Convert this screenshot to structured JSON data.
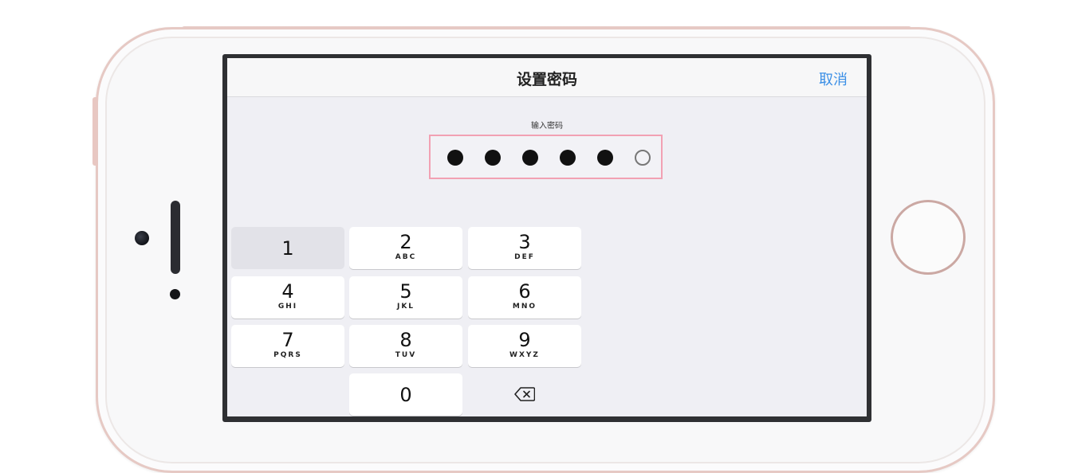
{
  "nav": {
    "title": "设置密码",
    "cancel_label": "取消"
  },
  "passcode": {
    "prompt": "输入密码",
    "length": 6,
    "filled": 5
  },
  "keypad": {
    "keys": [
      {
        "digit": "1",
        "letters": ""
      },
      {
        "digit": "2",
        "letters": "ABC"
      },
      {
        "digit": "3",
        "letters": "DEF"
      },
      {
        "digit": "4",
        "letters": "GHI"
      },
      {
        "digit": "5",
        "letters": "JKL"
      },
      {
        "digit": "6",
        "letters": "MNO"
      },
      {
        "digit": "7",
        "letters": "PQRS"
      },
      {
        "digit": "8",
        "letters": "TUV"
      },
      {
        "digit": "9",
        "letters": "WXYZ"
      },
      {
        "digit": "0",
        "letters": ""
      }
    ],
    "pressed_digit": "1",
    "delete_icon": "backspace-icon"
  },
  "colors": {
    "accent": "#3b8fe6",
    "pin_box_border": "#f2a1b3",
    "screen_bg": "#efeff4",
    "phone_rim": "#e6c9c4"
  }
}
